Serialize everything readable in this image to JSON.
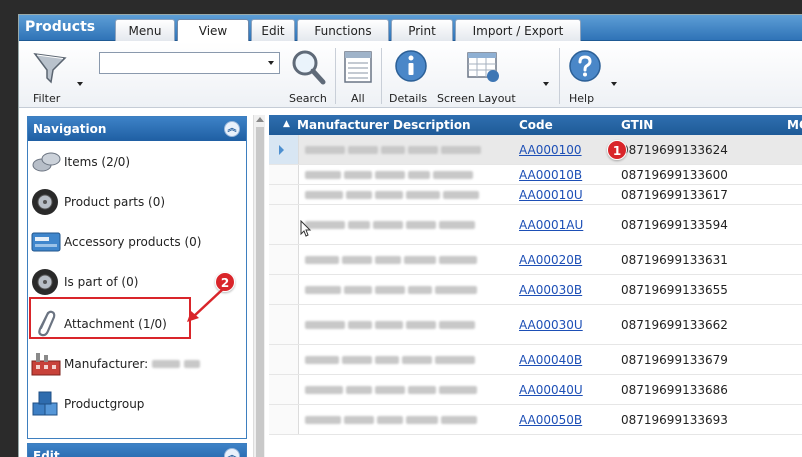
{
  "app_title": "Products",
  "tabs": [
    {
      "label": "Menu"
    },
    {
      "label": "View"
    },
    {
      "label": "Edit"
    },
    {
      "label": "Functions"
    },
    {
      "label": "Print"
    },
    {
      "label": "Import / Export"
    }
  ],
  "active_tab": "View",
  "toolbar": {
    "filter_label": "Filter",
    "combo_value": "",
    "search_label": "Search",
    "all_label": "All",
    "details_label": "Details",
    "screen_layout_label": "Screen Layout",
    "help_label": "Help"
  },
  "navigation": {
    "title": "Navigation",
    "items": [
      {
        "label": "Items (2/0)",
        "icon": "items-icon"
      },
      {
        "label": "Product parts (0)",
        "icon": "tire-icon"
      },
      {
        "label": "Accessory products (0)",
        "icon": "accessory-icon"
      },
      {
        "label": "Is part of (0)",
        "icon": "tire-icon"
      },
      {
        "label": "Attachment (1/0)",
        "icon": "paperclip-icon"
      },
      {
        "label": "Manufacturer:",
        "icon": "factory-icon"
      },
      {
        "label": "Productgroup",
        "icon": "cubes-icon"
      }
    ]
  },
  "edit_panel": {
    "title": "Edit"
  },
  "grid": {
    "columns": [
      "Manufacturer Description",
      "Code",
      "GTIN",
      "MO"
    ],
    "rows": [
      {
        "code": "AA000100",
        "gtin": "08719699133624"
      },
      {
        "code": "AA00010B",
        "gtin": "08719699133600"
      },
      {
        "code": "AA00010U",
        "gtin": "08719699133617"
      },
      {
        "code": "AA0001AU",
        "gtin": "08719699133594"
      },
      {
        "code": "AA00020B",
        "gtin": "08719699133631"
      },
      {
        "code": "AA00030B",
        "gtin": "08719699133655"
      },
      {
        "code": "AA00030U",
        "gtin": "08719699133662"
      },
      {
        "code": "AA00040B",
        "gtin": "08719699133679"
      },
      {
        "code": "AA00040U",
        "gtin": "08719699133686"
      },
      {
        "code": "AA00050B",
        "gtin": "08719699133693"
      }
    ]
  },
  "callouts": [
    "1",
    "2"
  ],
  "colors": {
    "accent": "#2f73b7",
    "header": "#1e5a97",
    "callout": "#d9252a",
    "link": "#1d4fb6"
  }
}
